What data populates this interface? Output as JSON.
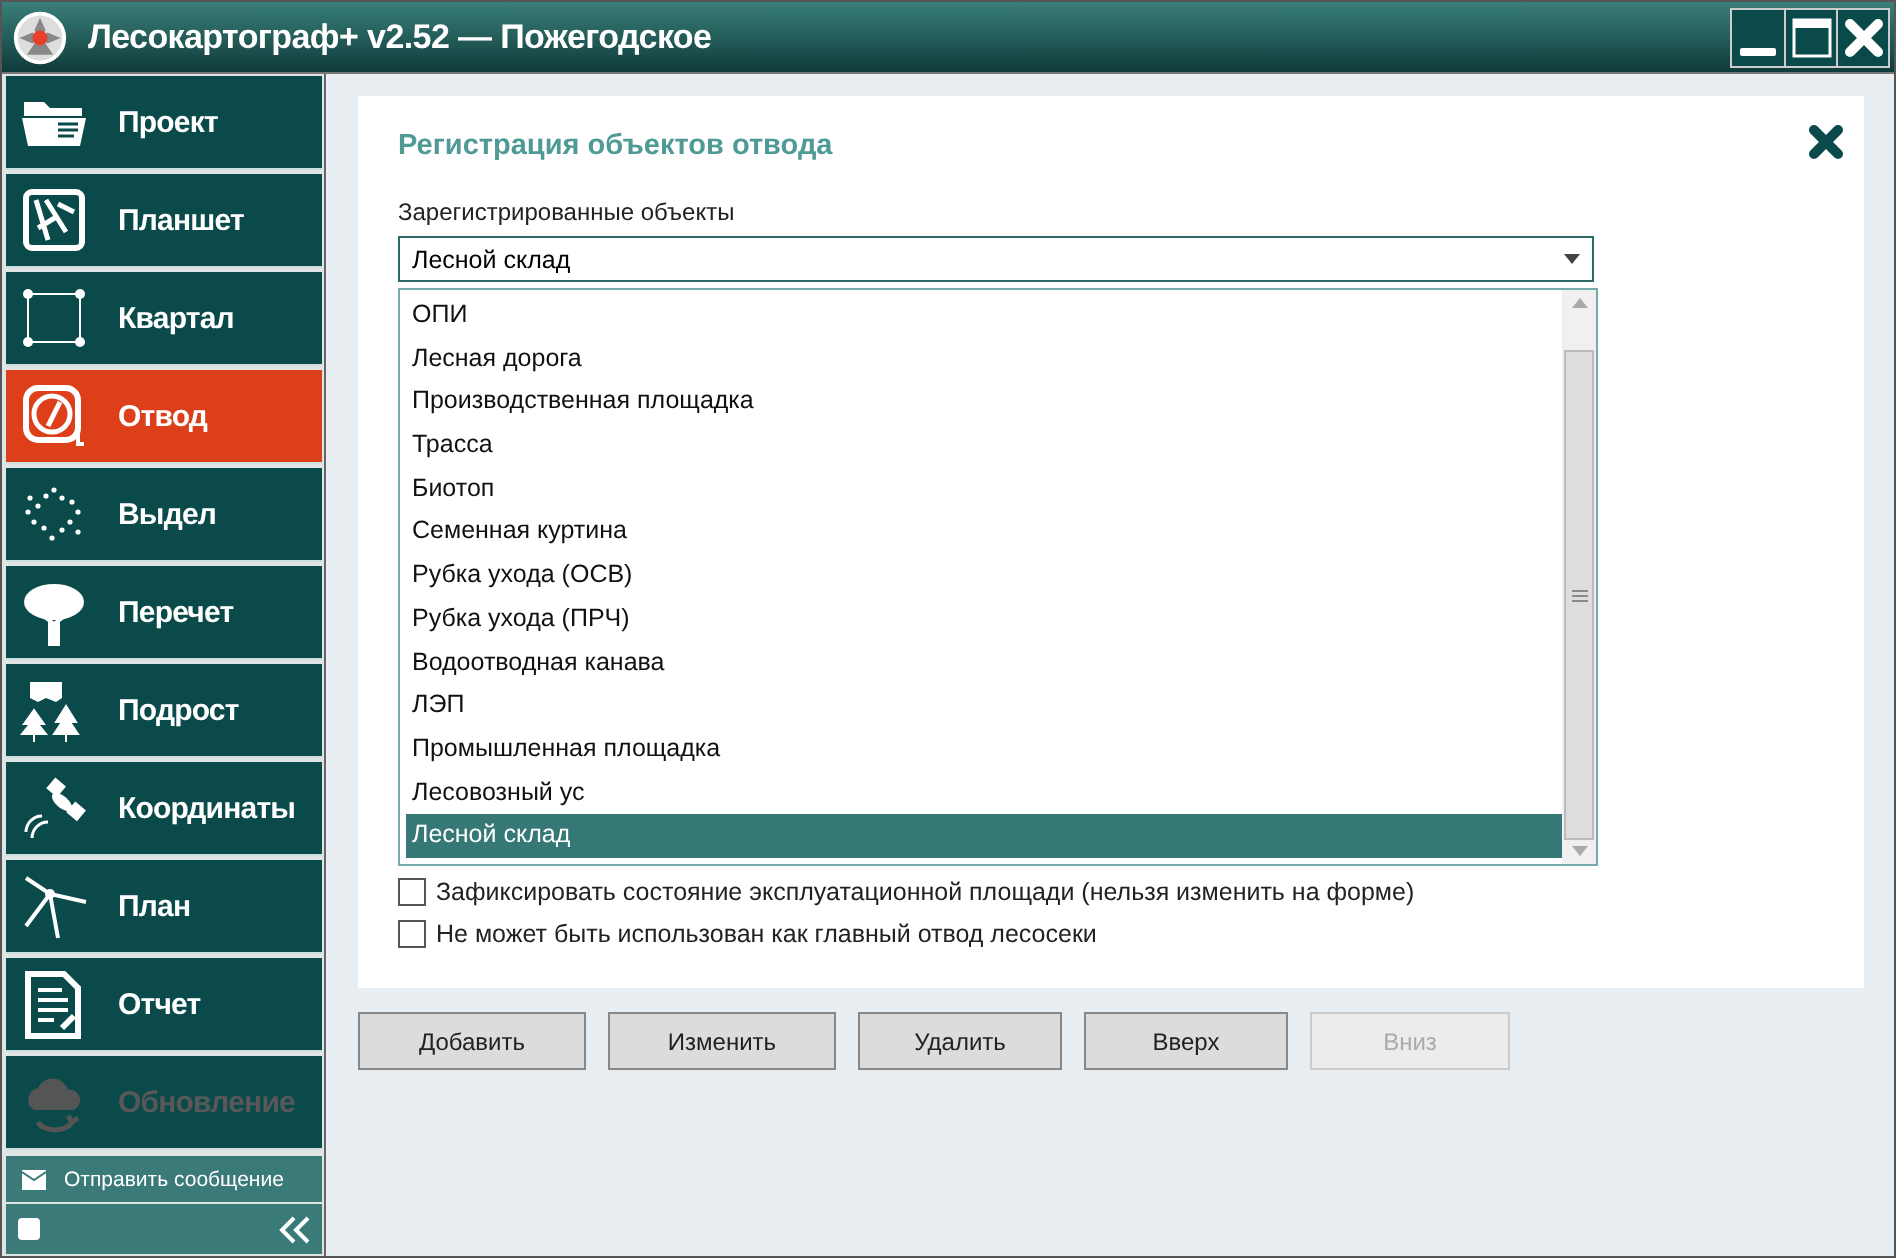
{
  "window": {
    "title": "Лесокартограф+ v2.52 — Пожегодское"
  },
  "sidebar": {
    "items": [
      {
        "label": "Проект",
        "selected": false,
        "disabled": false
      },
      {
        "label": "Планшет",
        "selected": false,
        "disabled": false
      },
      {
        "label": "Квартал",
        "selected": false,
        "disabled": false
      },
      {
        "label": "Отвод",
        "selected": true,
        "disabled": false
      },
      {
        "label": "Выдел",
        "selected": false,
        "disabled": false
      },
      {
        "label": "Перечет",
        "selected": false,
        "disabled": false
      },
      {
        "label": "Подрост",
        "selected": false,
        "disabled": false
      },
      {
        "label": "Координаты",
        "selected": false,
        "disabled": false
      },
      {
        "label": "План",
        "selected": false,
        "disabled": false
      },
      {
        "label": "Отчет",
        "selected": false,
        "disabled": false
      },
      {
        "label": "Обновление",
        "selected": false,
        "disabled": true
      }
    ],
    "send_message": "Отправить сообщение"
  },
  "form": {
    "title": "Регистрация объектов отвода",
    "field_label": "Зарегистрированные объекты",
    "combo_value": "Лесной склад",
    "list_items": [
      {
        "label": "ОПИ",
        "selected": false
      },
      {
        "label": "Лесная дорога",
        "selected": false
      },
      {
        "label": "Производственная площадка",
        "selected": false
      },
      {
        "label": "Трасса",
        "selected": false
      },
      {
        "label": "Биотоп",
        "selected": false
      },
      {
        "label": "Семенная куртина",
        "selected": false
      },
      {
        "label": "Рубка ухода (ОСВ)",
        "selected": false
      },
      {
        "label": "Рубка ухода (ПРЧ)",
        "selected": false
      },
      {
        "label": "Водоотводная канава",
        "selected": false
      },
      {
        "label": "ЛЭП",
        "selected": false
      },
      {
        "label": "Промышленная площадка",
        "selected": false
      },
      {
        "label": "Лесовозный ус",
        "selected": false
      },
      {
        "label": "Лесной склад",
        "selected": true
      }
    ],
    "checkboxes": [
      {
        "label": "Зафиксировать состояние эксплуатационной площади (нельзя изменить на форме)",
        "checked": false
      },
      {
        "label": "Не может быть использован как главный отвод лесосеки",
        "checked": false
      }
    ]
  },
  "buttons": [
    {
      "label": "Добавить",
      "disabled": false
    },
    {
      "label": "Изменить",
      "disabled": false
    },
    {
      "label": "Удалить",
      "disabled": false
    },
    {
      "label": "Вверх",
      "disabled": false
    },
    {
      "label": "Вниз",
      "disabled": true
    }
  ]
}
